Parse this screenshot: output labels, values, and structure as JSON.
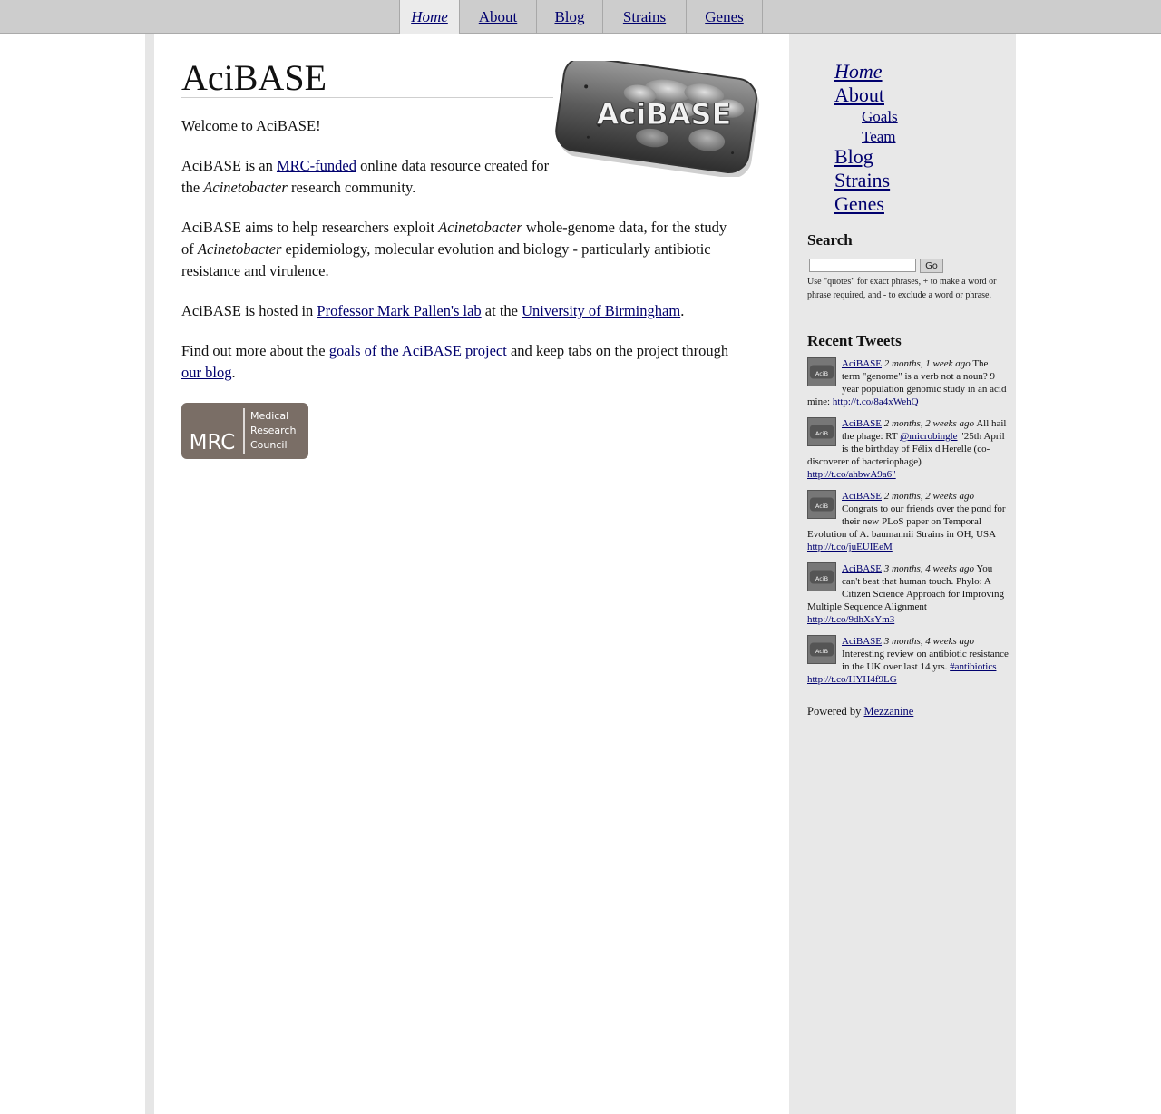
{
  "topnav": {
    "items": [
      {
        "label": "Home",
        "active": true
      },
      {
        "label": "About",
        "active": false
      },
      {
        "label": "Blog",
        "active": false
      },
      {
        "label": "Strains",
        "active": false
      },
      {
        "label": "Genes",
        "active": false
      }
    ]
  },
  "main": {
    "title": "AciBASE",
    "logo_text": "AciBASE",
    "welcome": "Welcome to AciBASE!",
    "p1": {
      "pre": "AciBASE is an ",
      "link": "MRC-funded",
      "mid": " online data resource created for the ",
      "italic": "Acinetobacter",
      "post": " research community."
    },
    "p2": {
      "pre": "AciBASE aims to help researchers exploit ",
      "italic1": "Acinetobacter",
      "mid": " whole-genome data, for the study of ",
      "italic2": "Acinetobacter",
      "post": " epidemiology, molecular evolution and biology - particularly antibiotic resistance and virulence."
    },
    "p3": {
      "pre": "AciBASE is hosted in ",
      "link1": "Professor Mark Pallen's lab",
      "mid": " at the ",
      "link2": "University of Birmingham",
      "post": "."
    },
    "p4": {
      "pre": "Find out more about the ",
      "link1": "goals of the AciBASE project",
      "mid": " and keep tabs on the project through ",
      "link2": "our blog",
      "post": "."
    },
    "mrc_logo": {
      "abbr": "MRC",
      "line1": "Medical",
      "line2": "Research",
      "line3": "Council",
      "color": "#7a6e66"
    }
  },
  "sidebar": {
    "nav": {
      "home": "Home",
      "about": "About",
      "goals": "Goals",
      "team": "Team",
      "blog": "Blog",
      "strains": "Strains",
      "genes": "Genes"
    },
    "search": {
      "heading": "Search",
      "button": "Go",
      "value": "",
      "help": "Use \"quotes\" for exact phrases, + to make a word or phrase required, and - to exclude a word or phrase."
    },
    "tweets_heading": "Recent Tweets",
    "tweets": [
      {
        "user": "AciBASE",
        "time": "2 months, 1 week ago",
        "text": " The term \"genome\" is a verb not a noun? 9 year population genomic study in an acid mine: ",
        "link": "http://t.co/8a4xWehQ",
        "pre_link": "",
        "mention": ""
      },
      {
        "user": "AciBASE",
        "time": "2 months, 2 weeks ago",
        "text": " All hail the phage: RT ",
        "mention": "@microbingle",
        "after_mention": " \"25th April is the birthday of Félix d'Herelle (co-discoverer of bacteriophage) ",
        "link": "http://t.co/ahbwA9a6\""
      },
      {
        "user": "AciBASE",
        "time": "2 months, 2 weeks ago",
        "text": " Congrats to our friends over the pond for their new PLoS paper on Temporal Evolution of A. baumannii Strains in OH, USA ",
        "link": "http://t.co/juEUIEeM"
      },
      {
        "user": "AciBASE",
        "time": "3 months, 4 weeks ago",
        "text": " You can't beat that human touch. Phylo: A Citizen Science Approach for Improving Multiple Sequence Alignment ",
        "link": "http://t.co/9dhXsYm3"
      },
      {
        "user": "AciBASE",
        "time": "3 months, 4 weeks ago",
        "text": " Interesting review on antibiotic resistance in the UK over last 14 yrs. ",
        "hashtag": "#antibiotics",
        "link": "http://t.co/HYH4f9LG"
      }
    ],
    "powered_pre": "Powered by ",
    "powered_link": "Mezzanine"
  }
}
